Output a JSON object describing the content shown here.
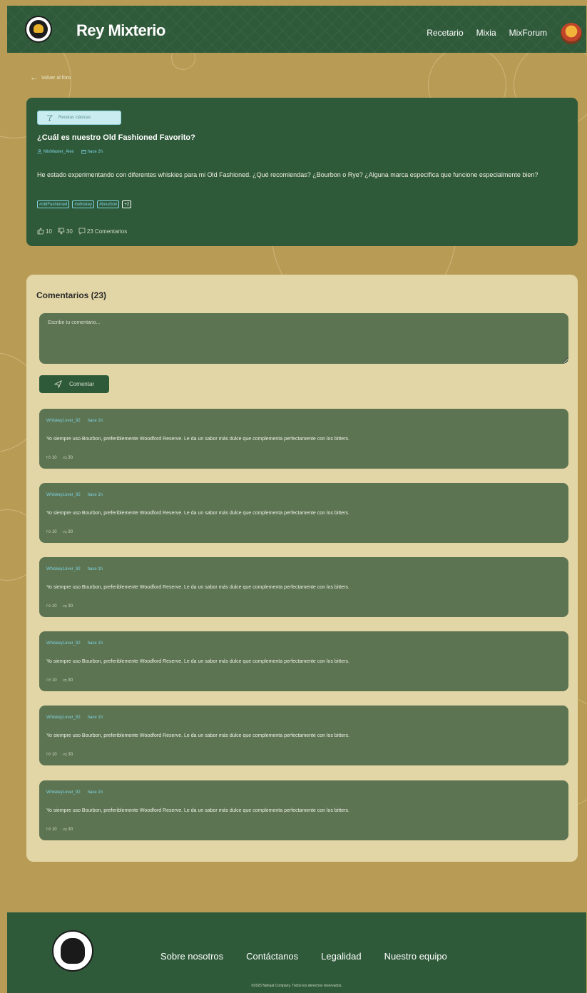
{
  "header": {
    "brand": "Rey Mixterio",
    "nav": [
      "Recetario",
      "Mixia",
      "MixForum"
    ]
  },
  "back_link": "Volver al foro",
  "post": {
    "category": "Recetas clásicas",
    "title": "¿Cuál es nuestro Old Fashioned Favorito?",
    "author": "MixMaster_Alex",
    "time": "hace 2h",
    "body": "He estado experimentando con diferentes whiskies para mi Old Fashioned. ¿Qué recomiendas? ¿Bourbon o Rye? ¿Alguna marca específica que funcione especialmente bien?",
    "tags": [
      "#oldFashioned",
      "#whiskey",
      "#bourbon",
      "+2"
    ],
    "likes": "10",
    "dislikes": "30",
    "comments_label": "23 Comentarios"
  },
  "comments_section": {
    "title": "Comentarios (23)",
    "input_placeholder": "Escribe tu comentario...",
    "submit_label": "Comentar",
    "comments": [
      {
        "author": "WhiskeyLover_92",
        "time": "hace 1h",
        "text": "Yo siempre uso Bourbon, preferiblemente Woodford Reserve. Le da un sabor más dulce que complementa perfectamente con los bitters.",
        "likes": "10",
        "dislikes": "30"
      },
      {
        "author": "WhiskeyLover_92",
        "time": "hace 1h",
        "text": "Yo siempre uso Bourbon, preferiblemente Woodford Reserve. Le da un sabor más dulce que complementa perfectamente con los bitters.",
        "likes": "10",
        "dislikes": "30"
      },
      {
        "author": "WhiskeyLover_92",
        "time": "hace 1h",
        "text": "Yo siempre uso Bourbon, preferiblemente Woodford Reserve. Le da un sabor más dulce que complementa perfectamente con los bitters.",
        "likes": "10",
        "dislikes": "30"
      },
      {
        "author": "WhiskeyLover_92",
        "time": "hace 1h",
        "text": "Yo siempre uso Bourbon, preferiblemente Woodford Reserve. Le da un sabor más dulce que complementa perfectamente con los bitters.",
        "likes": "10",
        "dislikes": "30"
      },
      {
        "author": "WhiskeyLover_92",
        "time": "hace 1h",
        "text": "Yo siempre uso Bourbon, preferiblemente Woodford Reserve. Le da un sabor más dulce que complementa perfectamente con los bitters.",
        "likes": "10",
        "dislikes": "30"
      },
      {
        "author": "WhiskeyLover_92",
        "time": "hace 1h",
        "text": "Yo siempre uso Bourbon, preferiblemente Woodford Reserve. Le da un sabor más dulce que complementa perfectamente con los bitters.",
        "likes": "10",
        "dislikes": "30"
      }
    ]
  },
  "footer": {
    "nav": [
      "Sobre nosotros",
      "Contáctanos",
      "Legalidad",
      "Nuestro equipo"
    ],
    "copyright": "©2025 Nahual Company. Todos los derechos reservados."
  },
  "colors": {
    "background": "#b89c56",
    "primary_green": "#2f5a3a",
    "card_green": "#5c7452",
    "panel_cream": "#e3d6a6",
    "accent_cyan": "#7fd2e0"
  },
  "icons": [
    "back-arrow-icon",
    "cocktail-icon",
    "user-icon",
    "calendar-icon",
    "thumbs-up-icon",
    "thumbs-down-icon",
    "chat-icon",
    "send-icon"
  ]
}
